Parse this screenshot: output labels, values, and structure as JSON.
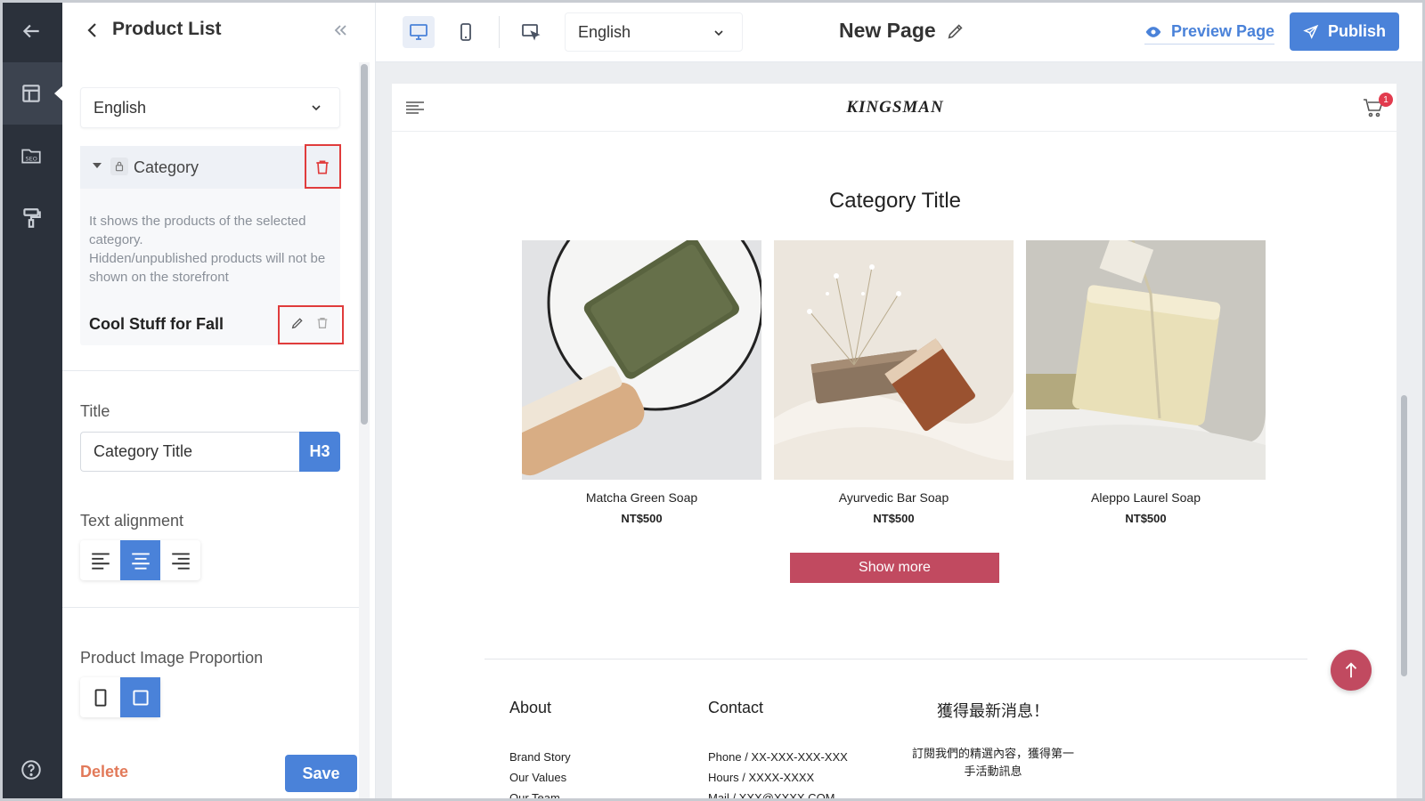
{
  "panel": {
    "title": "Product List",
    "language": "English",
    "category": {
      "label": "Category",
      "description": "It shows the products of the selected category.\nHidden/unpublished products will not be shown on the storefront",
      "collection": "Cool Stuff for Fall"
    },
    "title_field": {
      "label": "Title",
      "value": "Category Title",
      "heading_tag": "H3"
    },
    "text_alignment": {
      "label": "Text alignment",
      "options": [
        "left",
        "center",
        "right"
      ],
      "selected": "center"
    },
    "image_proportion": {
      "label": "Product Image Proportion",
      "options": [
        "portrait",
        "square"
      ],
      "selected": "square"
    },
    "delete_label": "Delete",
    "save_label": "Save"
  },
  "topbar": {
    "language": "English",
    "page_name": "New Page",
    "preview_label": "Preview Page",
    "publish_label": "Publish"
  },
  "store": {
    "brand": "KINGSMAN",
    "cart_count": "1",
    "section_title": "Category Title",
    "products": [
      {
        "name": "Matcha Green Soap",
        "price": "NT$500"
      },
      {
        "name": "Ayurvedic Bar Soap",
        "price": "NT$500"
      },
      {
        "name": "Aleppo Laurel Soap",
        "price": "NT$500"
      }
    ],
    "show_more": "Show more",
    "footer": {
      "about": {
        "heading": "About",
        "links": [
          "Brand Story",
          "Our Values",
          "Our Team"
        ]
      },
      "contact": {
        "heading": "Contact",
        "lines": [
          "Phone / XX-XXX-XXX-XXX",
          "Hours / XXXX-XXXX",
          "Mail / XXX@XXXX.COM"
        ]
      },
      "newsletter": {
        "heading": "獲得最新消息！",
        "text": "訂閱我們的精選內容，獲得第一手活動訊息"
      }
    }
  },
  "colors": {
    "accent": "#4a82d9",
    "rail": "#2b313b",
    "brand_button": "#c14a60",
    "highlight_box": "#e03c3c",
    "delete_text": "#e27a5a"
  }
}
